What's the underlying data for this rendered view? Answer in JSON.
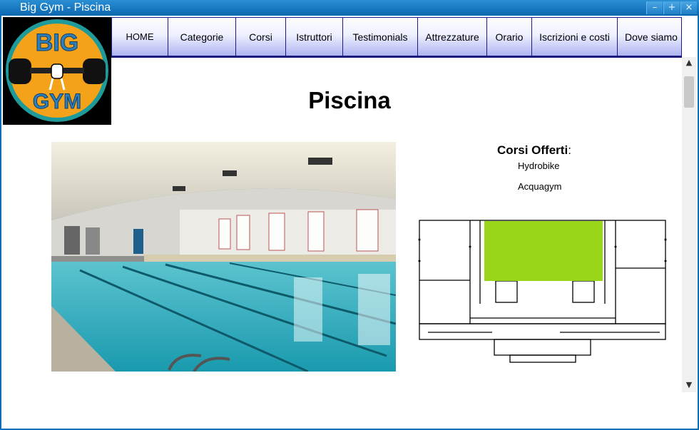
{
  "window": {
    "title": "Big Gym - Piscina",
    "controls": {
      "minimize": "minimize-icon",
      "maximize": "maximize-icon",
      "close": "close-icon"
    }
  },
  "logo": {
    "text_top": "BIG",
    "text_bottom": "GYM",
    "colors": {
      "ring": "#2f7fb8",
      "fill": "#f5a21b",
      "weights": "#111111"
    }
  },
  "nav": {
    "items": [
      {
        "label": "HOME"
      },
      {
        "label": "Categorie"
      },
      {
        "label": "Corsi"
      },
      {
        "label": "Istruttori"
      },
      {
        "label": "Testimonials"
      },
      {
        "label": "Attrezzature"
      },
      {
        "label": "Orario"
      },
      {
        "label": "Iscrizioni e costi"
      },
      {
        "label": "Dove siamo"
      }
    ]
  },
  "page": {
    "title": "Piscina",
    "courses_heading": "Corsi Offerti",
    "courses_colon": ":",
    "courses": [
      "Hydrobike",
      "Acquagym"
    ],
    "photo_icon": "swimming-pool-photo",
    "floorplan_icon": "floorplan-image",
    "highlight_color": "#99d61a"
  },
  "scrollbar": {
    "up": "▲",
    "down": "▼"
  }
}
